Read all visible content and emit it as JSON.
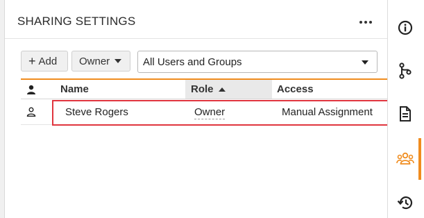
{
  "panel": {
    "title": "SHARING SETTINGS",
    "more_icon": "more-horizontal-icon"
  },
  "toolbar": {
    "add_label": "Add",
    "owner_label": "Owner",
    "group_select_value": "All Users and Groups"
  },
  "table": {
    "columns": [
      {
        "key": "user",
        "label": "",
        "icon": "user-icon"
      },
      {
        "key": "name",
        "label": "Name"
      },
      {
        "key": "role",
        "label": "Role",
        "sort": "ascending"
      },
      {
        "key": "access",
        "label": "Access"
      }
    ],
    "rows": [
      {
        "icon": "user-outline-icon",
        "name": "Steve Rogers",
        "role": "Owner",
        "access": "Manual Assignment"
      }
    ]
  },
  "right_bar": {
    "items": [
      {
        "icon": "info-icon"
      },
      {
        "icon": "branch-icon"
      },
      {
        "icon": "document-icon"
      },
      {
        "icon": "users-icon",
        "active": true
      },
      {
        "icon": "history-icon"
      }
    ]
  },
  "colors": {
    "accent": "#f08c1e",
    "highlight": "#e0353e"
  }
}
